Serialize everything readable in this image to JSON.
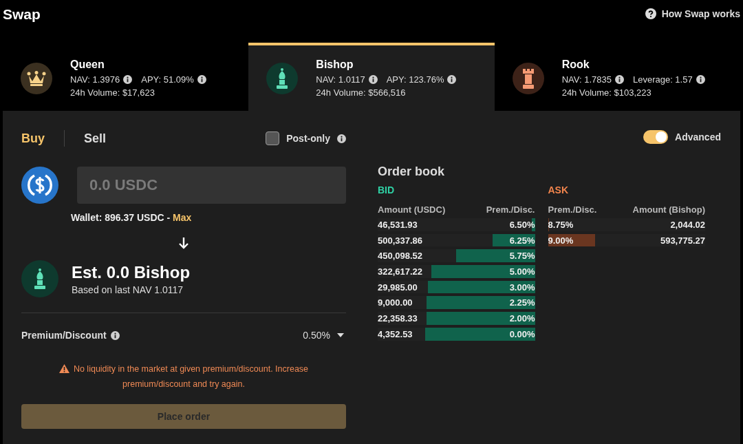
{
  "header": {
    "title": "Swap",
    "help_link": "How Swap works"
  },
  "markets": [
    {
      "kind": "queen",
      "name": "Queen",
      "nav": "NAV: 1.3976",
      "metric": "APY: 51.09%",
      "volume": "24h Volume: $17,623",
      "selected": false
    },
    {
      "kind": "bishop",
      "name": "Bishop",
      "nav": "NAV: 1.0117",
      "metric": "APY: 123.76%",
      "volume": "24h Volume: $566,516",
      "selected": true
    },
    {
      "kind": "rook",
      "name": "Rook",
      "nav": "NAV: 1.7835",
      "metric": "Leverage: 1.57",
      "volume": "24h Volume: $103,223",
      "selected": false
    }
  ],
  "trade": {
    "sides": [
      {
        "label": "Buy",
        "selected": true
      },
      {
        "label": "Sell",
        "selected": false
      }
    ],
    "post_only": {
      "label": "Post-only",
      "checked": false
    },
    "amount_field": {
      "placeholder": "0.0 USDC"
    },
    "wallet": "Wallet: 896.37 USDC - ",
    "max_link": "Max",
    "estimate": "Est. 0.0 Bishop",
    "estimate_note": "Based on last NAV 1.0117",
    "premium": {
      "label": "Premium/Discount",
      "value": "0.50%"
    },
    "warning": "No liquidity in the market at given premium/discount. Increase premium/discount and try again.",
    "place_order": {
      "label": "Place order",
      "disabled": true
    }
  },
  "order_book": {
    "advanced": {
      "label": "Advanced",
      "on": true
    },
    "title": "Order book",
    "bid": {
      "label": "BID",
      "columns": [
        "Amount (USDC)",
        "Prem./Disc."
      ],
      "rows": [
        {
          "amount": "46,531.93",
          "premium": "6.50%",
          "level": 0.02
        },
        {
          "amount": "500,337.86",
          "premium": "6.25%",
          "level": 0.27
        },
        {
          "amount": "450,098.52",
          "premium": "5.75%",
          "level": 0.5
        },
        {
          "amount": "322,617.22",
          "premium": "5.00%",
          "level": 0.66
        },
        {
          "amount": "29,985.00",
          "premium": "3.00%",
          "level": 0.68
        },
        {
          "amount": "9,000.00",
          "premium": "2.25%",
          "level": 0.69
        },
        {
          "amount": "22,358.33",
          "premium": "2.00%",
          "level": 0.69
        },
        {
          "amount": "4,352.53",
          "premium": "0.00%",
          "level": 0.7
        }
      ]
    },
    "ask": {
      "label": "ASK",
      "columns": [
        "Prem./Disc.",
        "Amount (Bishop)"
      ],
      "rows": [
        {
          "premium": "8.75%",
          "amount": "2,044.02",
          "level": 0.005
        },
        {
          "premium": "9.00%",
          "amount": "593,775.27",
          "level": 0.3
        }
      ]
    }
  }
}
